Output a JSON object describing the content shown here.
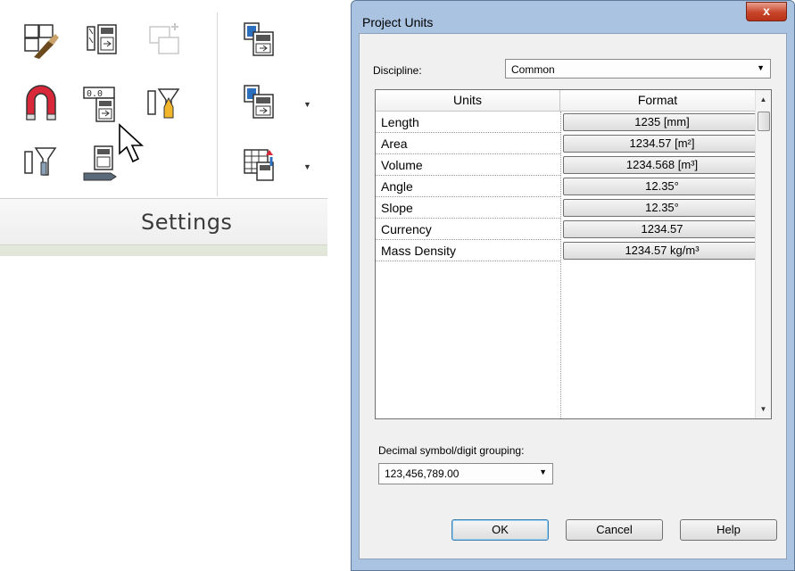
{
  "ribbon": {
    "panel_label": "Settings",
    "tools": [
      {
        "name": "object-styles-tool-icon"
      },
      {
        "name": "materials-tool-icon"
      },
      {
        "name": "disabled-tool-icon"
      },
      {
        "name": "snaps-tool-icon"
      },
      {
        "name": "project-units-tool-icon"
      },
      {
        "name": "shared-parameters-tool-icon"
      },
      {
        "name": "project-information-tool-icon"
      },
      {
        "name": "global-parameters-tool-icon"
      },
      {
        "name": "transfer-project-standards-tool-icon"
      },
      {
        "name": "purge-unused-tool-icon"
      },
      {
        "name": "structural-settings-tool-icon"
      },
      {
        "name": "mep-settings-tool-icon"
      }
    ]
  },
  "dialog": {
    "title": "Project Units",
    "close_label": "x",
    "discipline_label": "Discipline:",
    "discipline_value": "Common",
    "columns": [
      "Units",
      "Format"
    ],
    "rows": [
      {
        "unit": "Length",
        "format": "1235 [mm]"
      },
      {
        "unit": "Area",
        "format": "1234.57 [m²]"
      },
      {
        "unit": "Volume",
        "format": "1234.568 [m³]"
      },
      {
        "unit": "Angle",
        "format": "12.35°"
      },
      {
        "unit": "Slope",
        "format": "12.35°"
      },
      {
        "unit": "Currency",
        "format": "1234.57"
      },
      {
        "unit": "Mass Density",
        "format": "1234.57 kg/m³"
      }
    ],
    "decimal_label": "Decimal symbol/digit grouping:",
    "decimal_value": "123,456,789.00",
    "buttons": {
      "ok": "OK",
      "cancel": "Cancel",
      "help": "Help"
    }
  }
}
